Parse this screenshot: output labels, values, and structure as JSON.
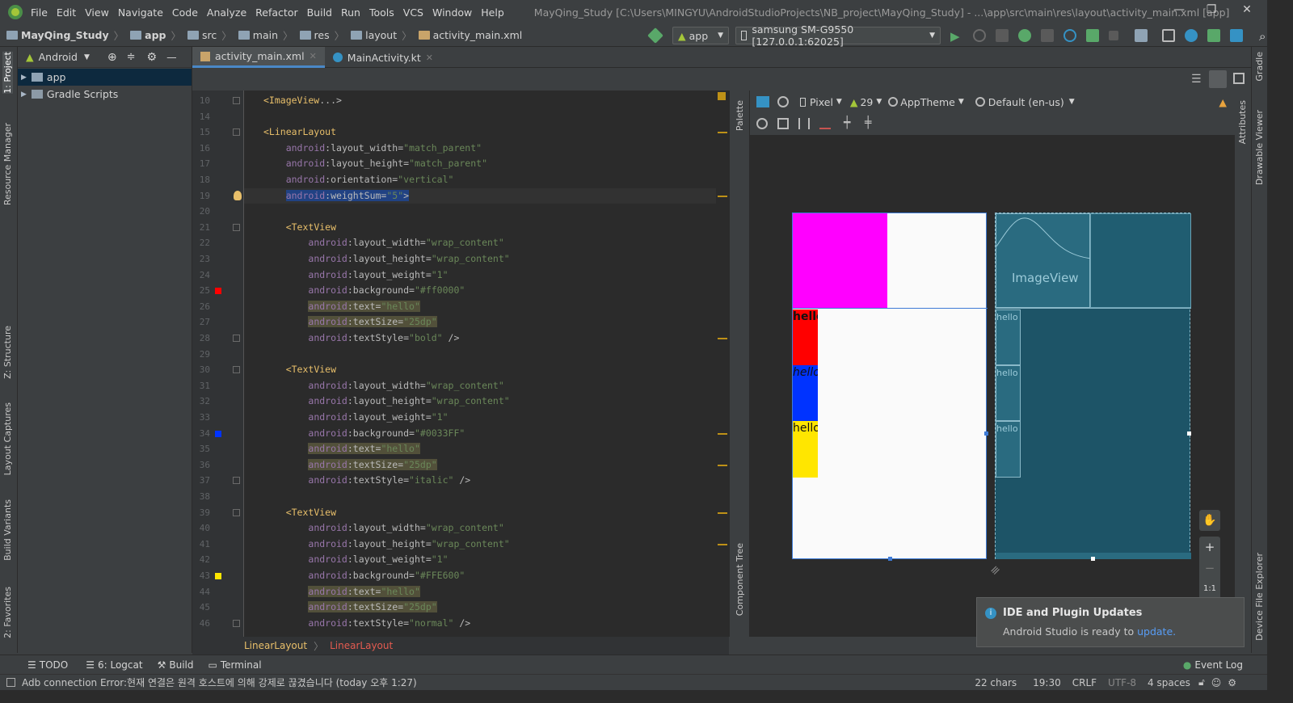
{
  "window": {
    "menu": [
      "File",
      "Edit",
      "View",
      "Navigate",
      "Code",
      "Analyze",
      "Refactor",
      "Build",
      "Run",
      "Tools",
      "VCS",
      "Window",
      "Help"
    ],
    "title": "MayQing_Study [C:\\Users\\MINGYU\\AndroidStudioProjects\\NB_project\\MayQing_Study] - ...\\app\\src\\main\\res\\layout\\activity_main.xml [app]"
  },
  "breadcrumbs": [
    "MayQing_Study",
    "app",
    "src",
    "main",
    "res",
    "layout",
    "activity_main.xml"
  ],
  "run_config": "app",
  "device": "samsung SM-G9550 [127.0.0.1:62025]",
  "project_panel": {
    "view_mode": "Android",
    "items": [
      "app",
      "Gradle Scripts"
    ]
  },
  "left_tool_tabs": [
    "1: Project",
    "Resource Manager",
    "Z: Structure",
    "Layout Captures",
    "Build Variants",
    "2: Favorites"
  ],
  "right_tool_tabs": [
    "Gradle",
    "Attributes",
    "Drawable Viewer",
    "Device File Explorer"
  ],
  "editor_tabs": [
    "activity_main.xml",
    "MainActivity.kt"
  ],
  "code_lines": [
    {
      "n": "10",
      "t": "<ImageView...>"
    },
    {
      "n": "14",
      "t": ""
    },
    {
      "n": "15",
      "t": "<LinearLayout"
    },
    {
      "n": "16",
      "t": "    android:layout_width=\"match_parent\""
    },
    {
      "n": "17",
      "t": "    android:layout_height=\"match_parent\""
    },
    {
      "n": "18",
      "t": "    android:orientation=\"vertical\""
    },
    {
      "n": "19",
      "t": "    android:weightSum=\"5\">"
    },
    {
      "n": "20",
      "t": ""
    },
    {
      "n": "21",
      "t": "    <TextView"
    },
    {
      "n": "22",
      "t": "        android:layout_width=\"wrap_content\""
    },
    {
      "n": "23",
      "t": "        android:layout_height=\"wrap_content\""
    },
    {
      "n": "24",
      "t": "        android:layout_weight=\"1\""
    },
    {
      "n": "25",
      "t": "        android:background=\"#ff0000\""
    },
    {
      "n": "26",
      "t": "        android:text=\"hello\""
    },
    {
      "n": "27",
      "t": "        android:textSize=\"25dp\""
    },
    {
      "n": "28",
      "t": "        android:textStyle=\"bold\" />"
    },
    {
      "n": "29",
      "t": ""
    },
    {
      "n": "30",
      "t": "    <TextView"
    },
    {
      "n": "31",
      "t": "        android:layout_width=\"wrap_content\""
    },
    {
      "n": "32",
      "t": "        android:layout_height=\"wrap_content\""
    },
    {
      "n": "33",
      "t": "        android:layout_weight=\"1\""
    },
    {
      "n": "34",
      "t": "        android:background=\"#0033FF\""
    },
    {
      "n": "35",
      "t": "        android:text=\"hello\""
    },
    {
      "n": "36",
      "t": "        android:textSize=\"25dp\""
    },
    {
      "n": "37",
      "t": "        android:textStyle=\"italic\" />"
    },
    {
      "n": "38",
      "t": ""
    },
    {
      "n": "39",
      "t": "    <TextView"
    },
    {
      "n": "40",
      "t": "        android:layout_width=\"wrap_content\""
    },
    {
      "n": "41",
      "t": "        android:layout_height=\"wrap_content\""
    },
    {
      "n": "42",
      "t": "        android:layout_weight=\"1\""
    },
    {
      "n": "43",
      "t": "        android:background=\"#FFE600\""
    },
    {
      "n": "44",
      "t": "        android:text=\"hello\""
    },
    {
      "n": "45",
      "t": "        android:textSize=\"25dp\""
    },
    {
      "n": "46",
      "t": "        android:textStyle=\"normal\" />"
    }
  ],
  "editor_breadcrumb": [
    "LinearLayout",
    "LinearLayout"
  ],
  "design_toolbar": {
    "device": "Pixel",
    "api": "29",
    "theme": "AppTheme",
    "locale": "Default (en-us)"
  },
  "design_side_tabs": [
    "Palette",
    "Component Tree"
  ],
  "preview": {
    "text_color_1": "#ff0000",
    "text_color_2": "#0033FF",
    "text_color_3": "#FFE600",
    "image_color": "#ff00ff",
    "hello": "hello",
    "imageview_label": "ImageView",
    "zoom_ratio": "1:1"
  },
  "bottom_tools": [
    "TODO",
    "6: Logcat",
    "Build",
    "Terminal"
  ],
  "event_log": "Event Log",
  "notification": {
    "title": "IDE and Plugin Updates",
    "body": "Android Studio is ready to ",
    "link": "update."
  },
  "status": {
    "message": "Adb connection Error:현재 연결은 원격 호스트에 의해 강제로 끊겼습니다 (today 오후 1:27)",
    "chars": "22 chars",
    "position": "19:30",
    "line_sep": "CRLF",
    "encoding": "UTF-8",
    "indent": "4 spaces"
  }
}
